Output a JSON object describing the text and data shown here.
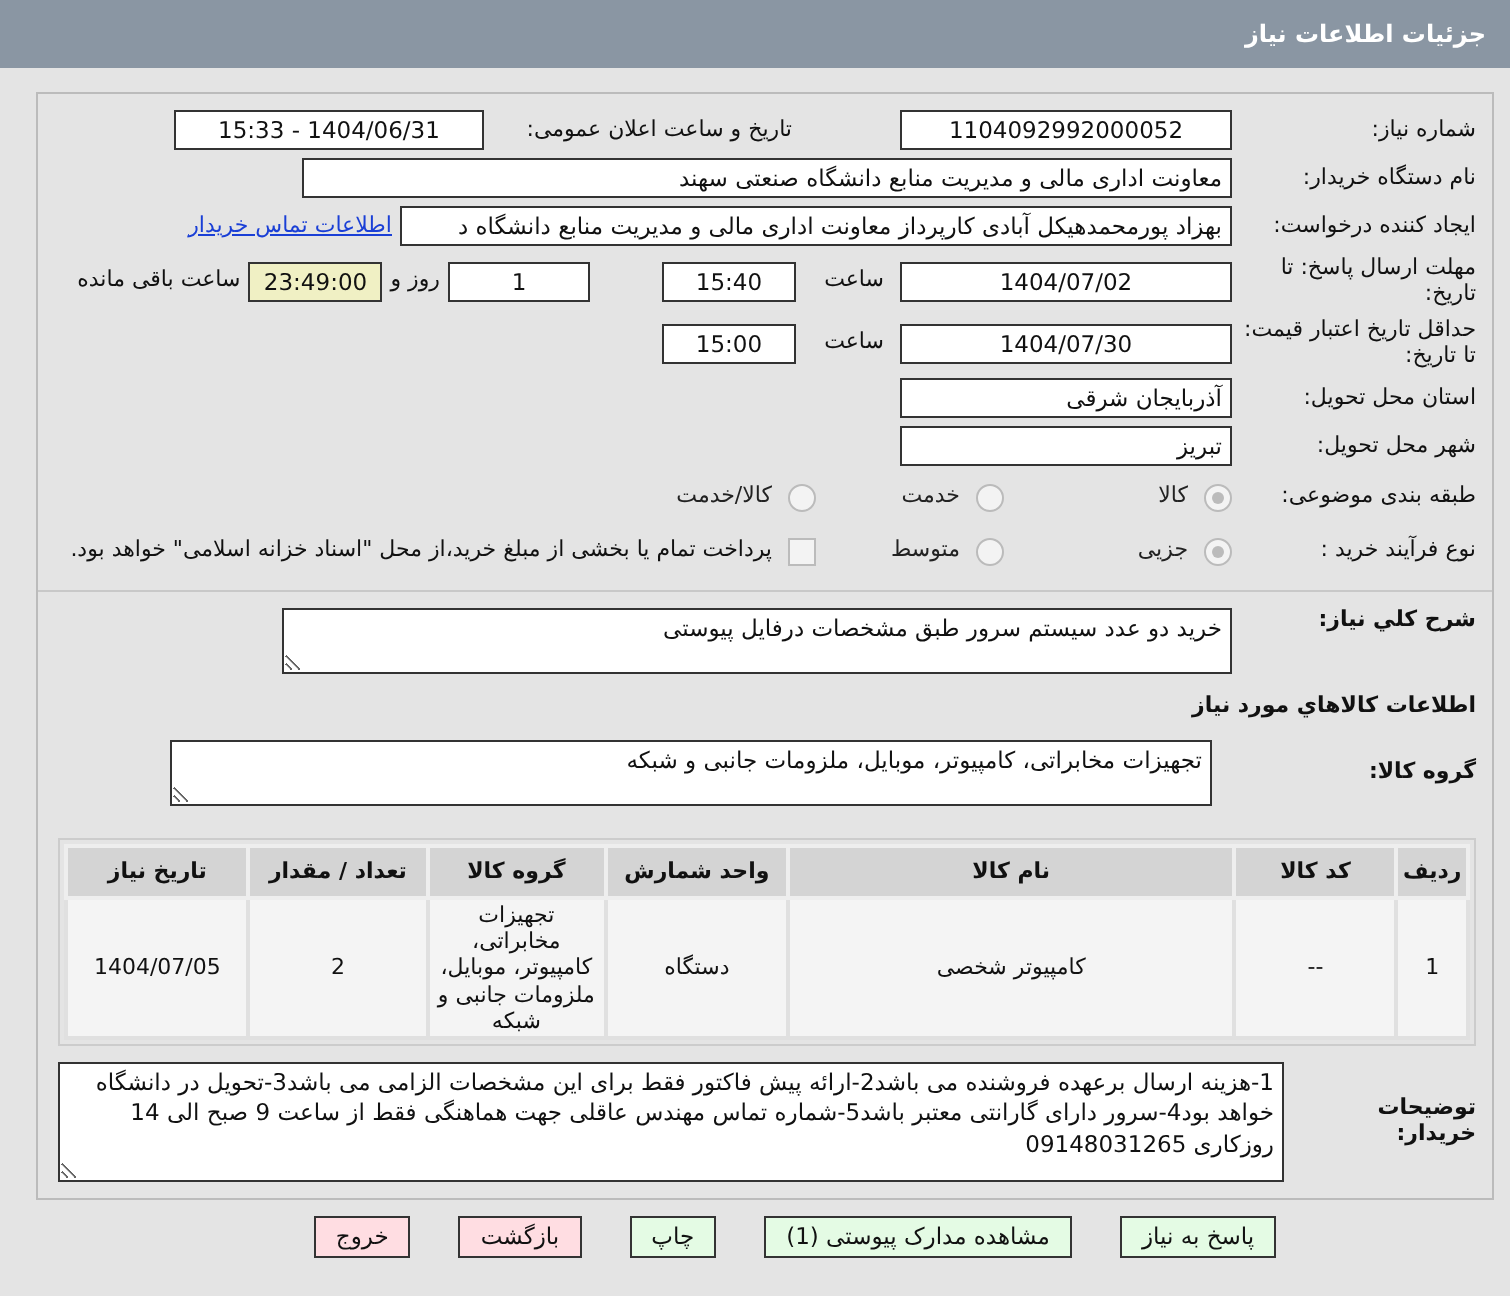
{
  "header": {
    "title": "جزئیات اطلاعات نیاز"
  },
  "need_number": {
    "label": "شماره نیاز:",
    "value": "1104092992000052"
  },
  "announce": {
    "label": "تاریخ و ساعت اعلان عمومی:",
    "value": "1404/06/31 - 15:33"
  },
  "buyer_org": {
    "label": "نام دستگاه خریدار:",
    "value": "معاونت اداری  مالی و مدیریت منابع دانشگاه صنعتی سهند"
  },
  "requester": {
    "label": "ایجاد کننده درخواست:",
    "value": "بهزاد پورمحمدهیکل آبادی کارپرداز معاونت اداری  مالی و مدیریت منابع دانشگاه د",
    "link": "اطلاعات تماس خریدار"
  },
  "deadline": {
    "label": "مهلت ارسال پاسخ: تا تاریخ:",
    "date": "1404/07/02",
    "time_label": "ساعت",
    "time": "15:40",
    "days": "1",
    "days_label": "روز و",
    "remaining": "23:49:00",
    "remaining_label": "ساعت باقی مانده"
  },
  "validity": {
    "label": "حداقل تاریخ اعتبار قیمت: تا تاریخ:",
    "date": "1404/07/30",
    "time_label": "ساعت",
    "time": "15:00"
  },
  "province": {
    "label": "استان محل تحویل:",
    "value": "آذربایجان شرقی"
  },
  "city": {
    "label": "شهر محل تحویل:",
    "value": "تبریز"
  },
  "category": {
    "label": "طبقه بندی موضوعی:",
    "options": [
      {
        "label": "کالا",
        "selected": true
      },
      {
        "label": "خدمت",
        "selected": false
      },
      {
        "label": "کالا/خدمت",
        "selected": false
      }
    ]
  },
  "process": {
    "label": "نوع فرآیند خرید :",
    "options": [
      {
        "label": "جزیی",
        "selected": true
      },
      {
        "label": "متوسط",
        "selected": false
      }
    ],
    "payment": {
      "checked": false,
      "text": "پرداخت تمام یا بخشی از مبلغ خرید،از محل \"اسناد خزانه اسلامی\" خواهد بود."
    }
  },
  "description": {
    "label": "شرح کلي نياز:",
    "value": "خرید دو عدد سیستم سرور طبق مشخصات درفایل پیوستی"
  },
  "goods_title": "اطلاعات کالاهاي مورد نياز",
  "goods_group": {
    "label": "گروه کالا:",
    "value": "تجهیزات مخابراتی، کامپیوتر، موبایل، ملزومات جانبی و شبکه"
  },
  "table": {
    "columns": [
      "ردیف",
      "کد کالا",
      "نام کالا",
      "واحد شمارش",
      "گروه کالا",
      "تعداد / مقدار",
      "تاریخ نیاز"
    ],
    "rows": [
      [
        "1",
        "--",
        "کامپیوتر شخصی",
        "دستگاه",
        "تجهیزات مخابراتی، کامپیوتر، موبایل، ملزومات جانبی و شبکه",
        "2",
        "1404/07/05"
      ]
    ]
  },
  "buyer_notes": {
    "label": "توضیحات خریدار:",
    "value": "1-هزینه ارسال برعهده فروشنده می باشد2-ارائه پیش فاکتور فقط برای این مشخصات الزامی می باشد3-تحویل در دانشگاه خواهد بود4-سرور دارای گارانتی معتبر باشد5-شماره تماس مهندس عاقلی جهت هماهنگی فقط از ساعت 9 صبح الی 14 روزکاری 09148031265"
  },
  "buttons": [
    {
      "label": "پاسخ به نیاز",
      "kind": "green"
    },
    {
      "label": "مشاهده مدارک پیوستی (1)",
      "kind": "green"
    },
    {
      "label": "چاپ",
      "kind": "green"
    },
    {
      "label": "بازگشت",
      "kind": "red"
    },
    {
      "label": "خروج",
      "kind": "red"
    }
  ]
}
